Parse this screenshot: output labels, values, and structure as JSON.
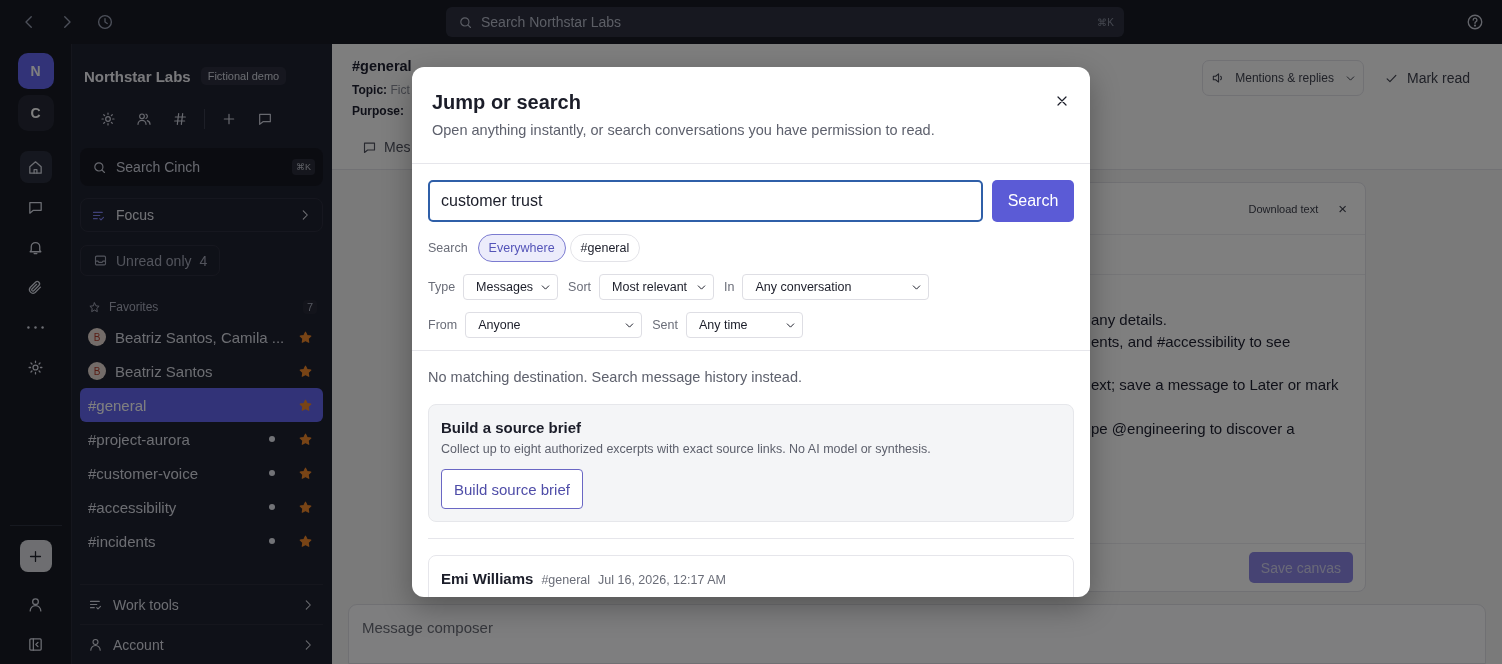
{
  "top_bar": {
    "search_placeholder": "Search Northstar Labs",
    "shortcut": "⌘K"
  },
  "rail": {
    "workspaces": [
      {
        "initial": "N",
        "selected": true
      },
      {
        "initial": "C",
        "selected": false
      }
    ],
    "nav": [
      {
        "kind": "home",
        "selected": true
      },
      {
        "kind": "chat",
        "selected": false
      },
      {
        "kind": "bell",
        "selected": false
      },
      {
        "kind": "clip",
        "selected": false
      },
      {
        "kind": "more",
        "selected": false
      },
      {
        "kind": "sun",
        "selected": false
      }
    ],
    "bottom": [
      {
        "kind": "plus"
      },
      {
        "kind": "person"
      },
      {
        "kind": "collapse"
      }
    ]
  },
  "sidebar": {
    "workspace": "Northstar Labs",
    "badge": "Fictional demo",
    "tools": [
      {
        "kind": "sun"
      },
      {
        "kind": "people"
      },
      {
        "kind": "hash"
      },
      {
        "kind": "plus"
      },
      {
        "kind": "chat"
      }
    ],
    "search": {
      "placeholder": "Search Cinch",
      "shortcut": "⌘K"
    },
    "focus": "Focus",
    "unread_filter": {
      "label": "Unread only",
      "count": "4",
      "on": false
    },
    "favorites": {
      "title": "Favorites",
      "count": "7",
      "items": [
        {
          "label": "Beatriz Santos, Camila ...",
          "avatar": "B",
          "selected": false,
          "unread": false,
          "starred": true
        },
        {
          "label": "Beatriz Santos",
          "avatar": "B",
          "selected": false,
          "unread": false,
          "starred": true
        },
        {
          "label": "#general",
          "selected": true,
          "unread": false,
          "starred": true
        },
        {
          "label": "#project-aurora",
          "selected": false,
          "unread": true,
          "starred": true
        },
        {
          "label": "#customer-voice",
          "selected": false,
          "unread": true,
          "starred": true
        },
        {
          "label": "#accessibility",
          "selected": false,
          "unread": true,
          "starred": true
        },
        {
          "label": "#incidents",
          "selected": false,
          "unread": true,
          "starred": true
        }
      ]
    },
    "footer": [
      {
        "label": "Work tools",
        "kind": "tools"
      },
      {
        "label": "Account",
        "kind": "account"
      }
    ]
  },
  "channel": {
    "name": "#general",
    "topic_label": "Topic:",
    "topic": "Fict",
    "purpose_label": "Purpose:",
    "tab": "Mes",
    "notify": "Mentions & replies",
    "mark_read": "Mark read"
  },
  "canvas": {
    "download": "Download text",
    "close": "×",
    "lines": [
      "any details.",
      "ents, and #accessibility to see",
      "ext; save a message to Later or mark",
      "pe @engineering to discover a"
    ],
    "save": "Save canvas"
  },
  "composer": {
    "placeholder": "Message composer"
  },
  "dialog": {
    "title": "Jump or search",
    "subtitle": "Open anything instantly, or search conversations you have permission to read.",
    "query": "customer trust",
    "search_button": "Search",
    "scope": {
      "label": "Search",
      "options": [
        {
          "label": "Everywhere",
          "selected": true
        },
        {
          "label": "#general",
          "selected": false
        }
      ]
    },
    "filters": [
      [
        {
          "label": "Type",
          "value": "Messages"
        },
        {
          "label": "Sort",
          "value": "Most relevant"
        },
        {
          "label": "In",
          "value": "Any conversation"
        }
      ],
      [
        {
          "label": "From",
          "value": "Anyone"
        },
        {
          "label": "Sent",
          "value": "Any time"
        }
      ]
    ],
    "notice": "No matching destination. Search message history instead.",
    "brief": {
      "title": "Build a source brief",
      "text": "Collect up to eight authorized excerpts with exact source links. No AI model or synthesis.",
      "button": "Build source brief"
    },
    "results": [
      {
        "author": "Emi Williams",
        "channel": "#general",
        "time": "Jul 16, 2026, 12:17 AM"
      }
    ]
  }
}
